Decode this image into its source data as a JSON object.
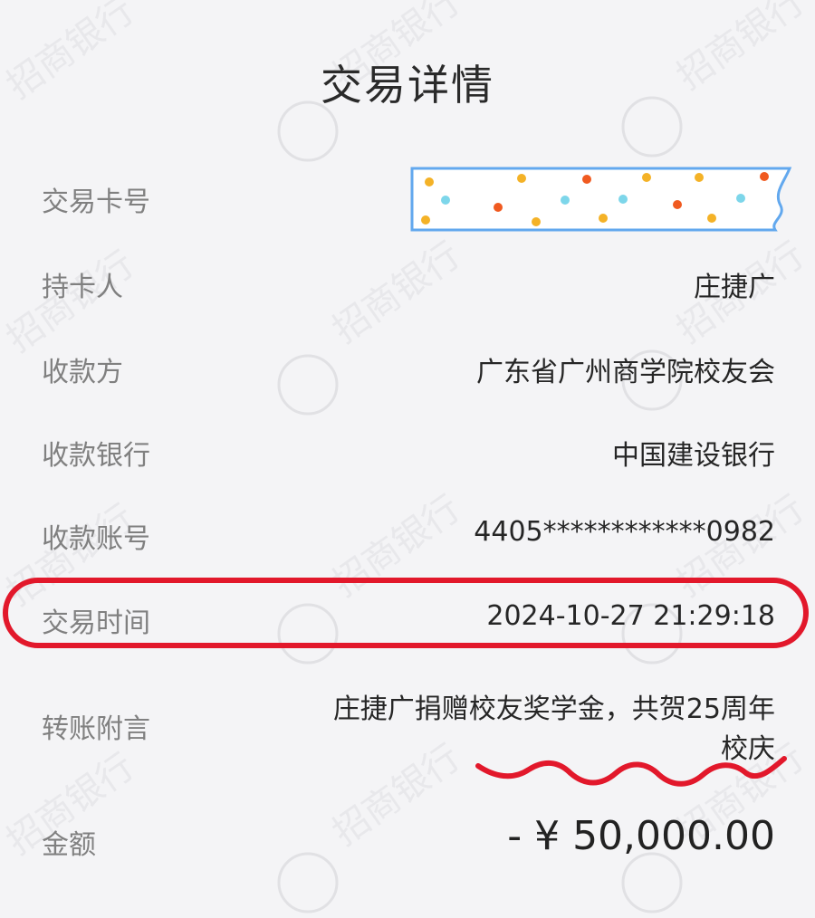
{
  "page": {
    "title": "交易详情"
  },
  "details": {
    "card_label": "交易卡号",
    "holder_label": "持卡人",
    "holder_value": "庄捷广",
    "payee_label": "收款方",
    "payee_value": "广东省广州商学院校友会",
    "bank_label": "收款银行",
    "bank_value": "中国建设银行",
    "account_label": "收款账号",
    "account_value": "4405************0982",
    "time_label": "交易时间",
    "time_value": "2024-10-27 21:29:18",
    "memo_label": "转账附言",
    "memo_line1": "庄捷广捐赠校友奖学金，共贺25周年",
    "memo_line2": "校庆",
    "amount_label": "金额",
    "amount_value": "- ¥ 50,000.00"
  },
  "watermark": {
    "text": "招商银行"
  },
  "colors": {
    "highlight": "#e2182b",
    "tape_border": "#62a8ee",
    "dot_yellow": "#f4b227",
    "dot_orange": "#f05a20",
    "dot_cyan": "#7dd6ea"
  }
}
